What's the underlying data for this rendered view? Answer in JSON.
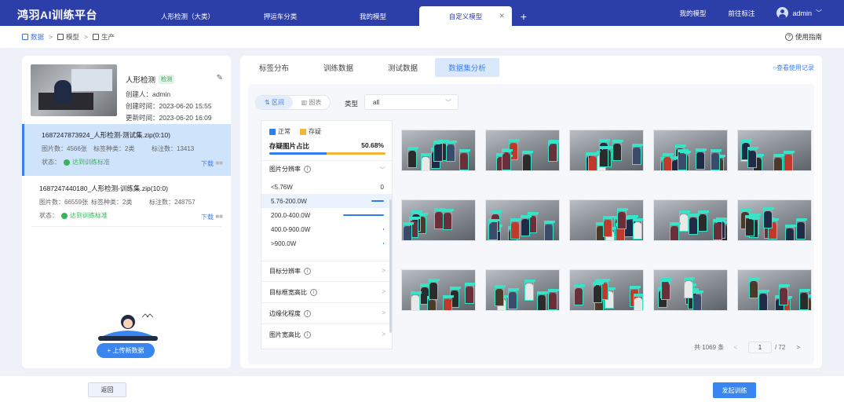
{
  "app": {
    "title": "鸿羽AI训练平台"
  },
  "tabs": [
    {
      "label": "人形检测（大类）"
    },
    {
      "label": "押运车分类"
    },
    {
      "label": "我的模型"
    },
    {
      "label": "自定义模型",
      "active": true
    }
  ],
  "header": {
    "my_models": "我的模型",
    "goto_annotate": "前往标注",
    "user": "admin"
  },
  "breadcrumb": [
    "数据",
    "模型",
    "生产"
  ],
  "guide": "使用指南",
  "project": {
    "title": "人形检测",
    "tag": "检测",
    "creator": "创建人：admin",
    "created": "创建时间：2023-06-20 15:55",
    "updated": "更新时间：2023-06-20 16:09"
  },
  "datasets": [
    {
      "name": "1687247873924_人形检测-测试集.zip(0:10)",
      "images": "图片数：4566张",
      "label_kinds": "标签种类：2类",
      "labeled": "标注数：13413",
      "status_label": "状态：",
      "status": "达到训练标准",
      "download": "下载"
    },
    {
      "name": "1687247440180_人形检测-训练集.zip(10:0)",
      "images": "图片数：66559张",
      "label_kinds": "标签种类：2类",
      "labeled": "标注数：248757",
      "status_label": "状态：",
      "status": "达到训练标准",
      "download": "下载"
    }
  ],
  "upload_label": "+ 上传新数据",
  "main_tabs": [
    {
      "label": "标签分布"
    },
    {
      "label": "训练数据"
    },
    {
      "label": "测试数据"
    },
    {
      "label": "数据集分析",
      "active": true
    }
  ],
  "history": "查看使用记录",
  "view_toggle": {
    "interval": "区间",
    "chart": "图表"
  },
  "type_filter": {
    "label": "类型",
    "value": "all"
  },
  "legend": {
    "normal": "正常",
    "suspicious": "存疑"
  },
  "suspicious_ratio": {
    "label": "存疑图片占比",
    "value": "50.68%",
    "fraction": 0.4932
  },
  "resolution": {
    "title": "图片分辨率",
    "bins": [
      {
        "label": "<5.76W",
        "count": "0",
        "level": 0
      },
      {
        "label": "5.76-200.0W",
        "level": 0.3
      },
      {
        "label": "200.0-400.0W",
        "level": 1.0
      },
      {
        "label": "400.0-900.0W",
        "level": 0.02
      },
      {
        "label": ">900.0W",
        "level": 0.01
      }
    ]
  },
  "sections": [
    {
      "label": "目标分辨率"
    },
    {
      "label": "目标框宽高比"
    },
    {
      "label": "边缘化程度"
    },
    {
      "label": "图片宽高比"
    }
  ],
  "pagination": {
    "total": "共 1069 条",
    "current": "1",
    "total_pages": "/ 72"
  },
  "footer": {
    "back": "返回",
    "train": "发起训练"
  },
  "colors": {
    "brand": "#2c3ea8",
    "accent": "#3a7ef5",
    "normal": "#2f7df0",
    "suspicious": "#f0b53a",
    "ok": "#38b45a"
  }
}
